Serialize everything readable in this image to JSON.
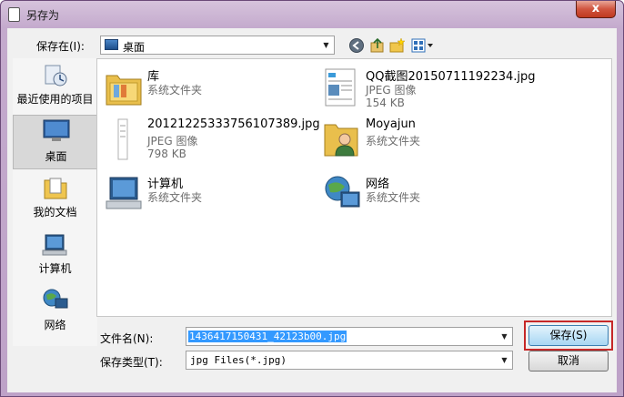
{
  "window": {
    "title": "另存为",
    "close_label": "x"
  },
  "toolbar": {
    "save_in_label": "保存在(I):",
    "location": "桌面"
  },
  "places": [
    {
      "label": "最近使用的项目",
      "icon": "recent-items-icon"
    },
    {
      "label": "桌面",
      "icon": "desktop-icon",
      "selected": true
    },
    {
      "label": "我的文档",
      "icon": "documents-icon"
    },
    {
      "label": "计算机",
      "icon": "computer-icon"
    },
    {
      "label": "网络",
      "icon": "network-icon"
    }
  ],
  "files": [
    {
      "name": "库",
      "line1": "系统文件夹",
      "line2": "",
      "icon": "library-folder-icon"
    },
    {
      "name": "QQ截图20150711192234.jpg",
      "line1": "JPEG 图像",
      "line2": "154 KB",
      "icon": "jpg-thumbnail-icon"
    },
    {
      "name": "20121225333756107389.jpg",
      "line1": "JPEG 图像",
      "line2": "798 KB",
      "icon": "jpg-thumbnail-icon"
    },
    {
      "name": "Moyajun",
      "line1": "系统文件夹",
      "line2": "",
      "icon": "user-folder-icon"
    },
    {
      "name": "计算机",
      "line1": "系统文件夹",
      "line2": "",
      "icon": "computer-icon"
    },
    {
      "name": "网络",
      "line1": "系统文件夹",
      "line2": "",
      "icon": "network-icon"
    }
  ],
  "form": {
    "filename_label": "文件名(N):",
    "filename_value": "1436417150431_42123b00.jpg",
    "filetype_label": "保存类型(T):",
    "filetype_value": "jpg Files(*.jpg)"
  },
  "buttons": {
    "save": "保存(S)",
    "cancel": "取消"
  },
  "colors": {
    "accent": "#3399ff",
    "highlight": "#c62828"
  }
}
